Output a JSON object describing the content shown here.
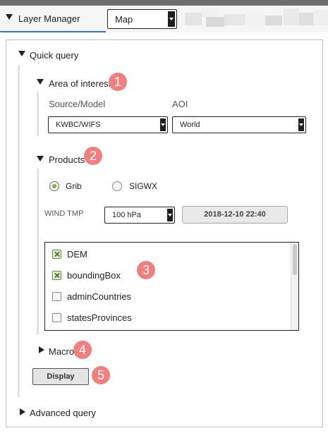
{
  "header": {
    "title": "Layer Manager",
    "map_select": "Map"
  },
  "quick_query": {
    "title": "Quick query",
    "area_of_interest": {
      "title": "Area of interest",
      "source_label": "Source/Model",
      "aoi_label": "AOI",
      "source_value": "KWBC/WIFS",
      "aoi_value": "World"
    },
    "products": {
      "title": "Products",
      "radio_grib": "Grib",
      "radio_sigwx": "SIGWX",
      "selected": "Grib",
      "param_label": "WIND TMP",
      "level_value": "100 hPa",
      "date_value": "2018-12-10 22:40",
      "layers": [
        {
          "label": "DEM",
          "checked": true
        },
        {
          "label": "boundingBox",
          "checked": true
        },
        {
          "label": "adminCountries",
          "checked": false
        },
        {
          "label": "statesProvinces",
          "checked": false
        }
      ]
    },
    "macro": {
      "title": "Macro"
    },
    "display_label": "Display"
  },
  "advanced_query": {
    "title": "Advanced query"
  },
  "callouts": [
    "1",
    "2",
    "3",
    "4",
    "5"
  ],
  "colors": {
    "accent": "#3b6fc5",
    "callout": "#f08080",
    "checked": "#7fae3e"
  }
}
